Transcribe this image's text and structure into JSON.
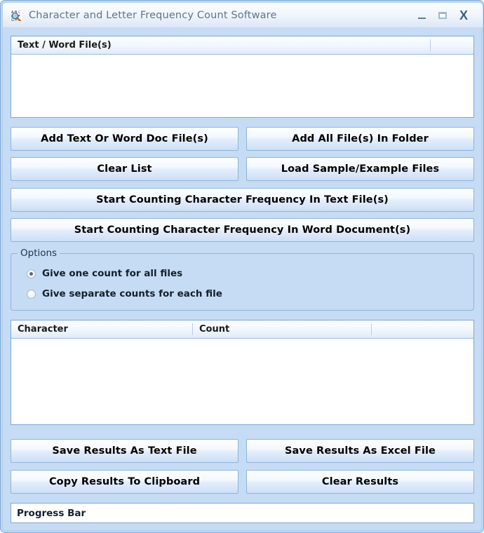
{
  "window": {
    "title": "Character and Letter Frequency Count Software",
    "icon": "app-letters-magnifier-icon",
    "controls": {
      "minimize": "–",
      "maximize": "□",
      "close": "X"
    }
  },
  "file_list": {
    "columns": [
      "Text / Word File(s)",
      ""
    ],
    "rows": []
  },
  "file_buttons": {
    "add_files": "Add Text Or Word Doc File(s)",
    "add_folder": "Add All File(s) In Folder",
    "clear_list": "Clear List",
    "load_samples": "Load Sample/Example Files"
  },
  "action_buttons": {
    "start_text": "Start Counting Character Frequency In Text File(s)",
    "start_word": "Start Counting Character Frequency In Word Document(s)"
  },
  "options": {
    "legend": "Options",
    "items": [
      {
        "label": "Give one count for all files",
        "selected": true
      },
      {
        "label": "Give separate counts for each file",
        "selected": false
      }
    ]
  },
  "results_table": {
    "columns": [
      "Character",
      "Count",
      ""
    ],
    "rows": []
  },
  "results_buttons": {
    "save_text": "Save Results As Text File",
    "save_excel": "Save Results As Excel File",
    "copy_clipboard": "Copy Results To Clipboard",
    "clear_results": "Clear Results"
  },
  "progress": {
    "label": "Progress Bar",
    "value": 0
  },
  "colors": {
    "window_background": "#c6dcf4",
    "window_border": "#7ba7d7",
    "button_border": "#8fb3da",
    "panel_border": "#7ea7d4",
    "title_text": "#5b768f"
  }
}
